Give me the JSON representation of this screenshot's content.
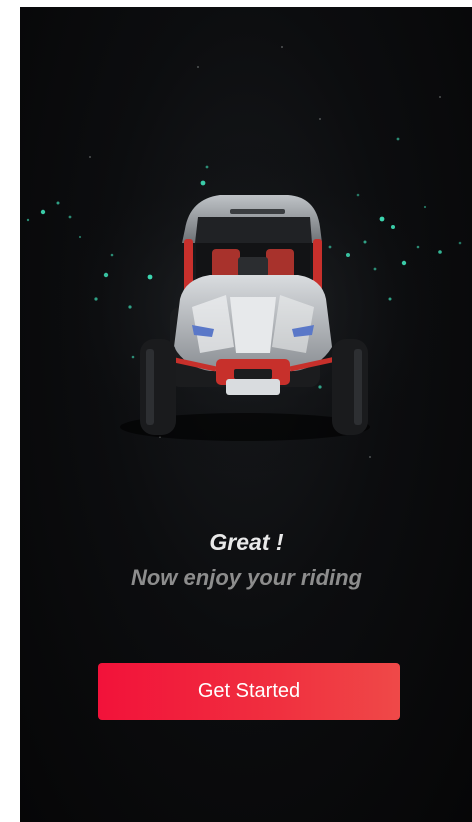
{
  "screen": {
    "title": "Great !",
    "subtitle": "Now enjoy your riding",
    "cta_label": "Get Started"
  },
  "hero": {
    "image": "off-road-buggy-vehicle",
    "particle_color": "#3fe0b8"
  },
  "colors": {
    "background": "#0b0c0e",
    "accent": "#f2123a",
    "title_text": "#e9e9e9",
    "subtitle_text": "#8d8d8d"
  }
}
